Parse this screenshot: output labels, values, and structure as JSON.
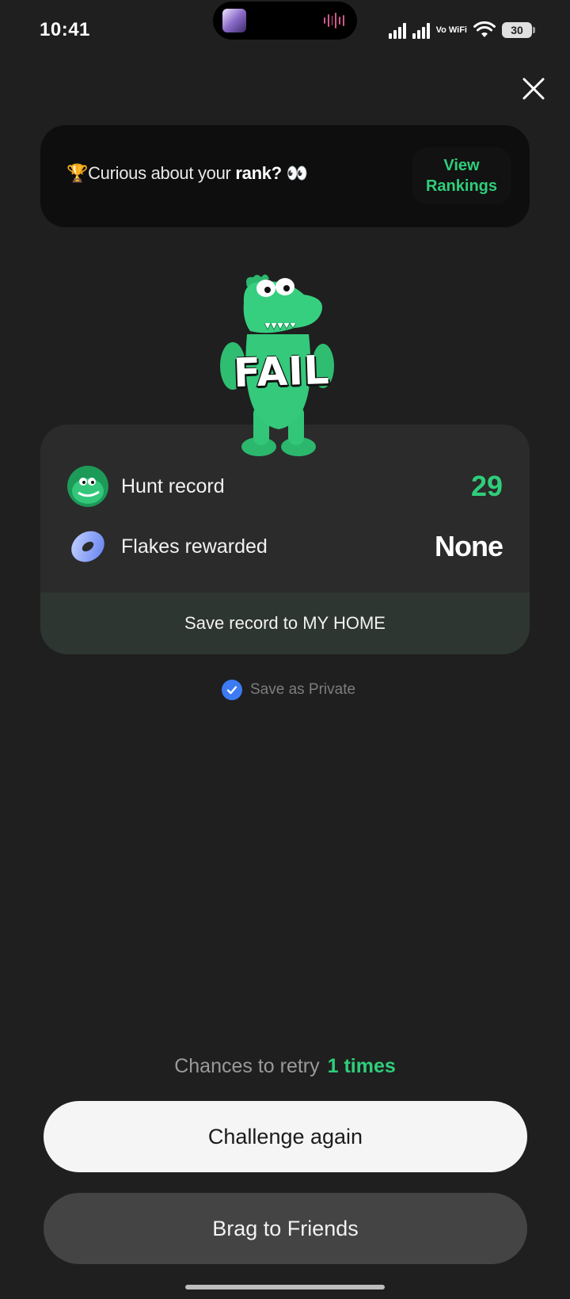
{
  "status_bar": {
    "time": "10:41",
    "network": "Vo WiFi",
    "battery": "30"
  },
  "banner": {
    "prefix": "🏆Curious about your ",
    "highlight": "rank?",
    "suffix": " 👀",
    "button_line1": "View",
    "button_line2": "Rankings"
  },
  "mascot": {
    "overlay_text": "FAIL"
  },
  "result": {
    "hunt_label": "Hunt record",
    "hunt_value": "29",
    "flakes_label": "Flakes rewarded",
    "flakes_value": "None",
    "save_label": "Save record to MY HOME"
  },
  "privacy": {
    "label": "Save as Private",
    "checked": true
  },
  "retry": {
    "label": "Chances to retry",
    "count": "1 times"
  },
  "buttons": {
    "challenge": "Challenge again",
    "brag": "Brag to Friends"
  },
  "colors": {
    "accent_green": "#2fce7a",
    "background": "#1f1f1f",
    "check_blue": "#3c7bf4"
  }
}
